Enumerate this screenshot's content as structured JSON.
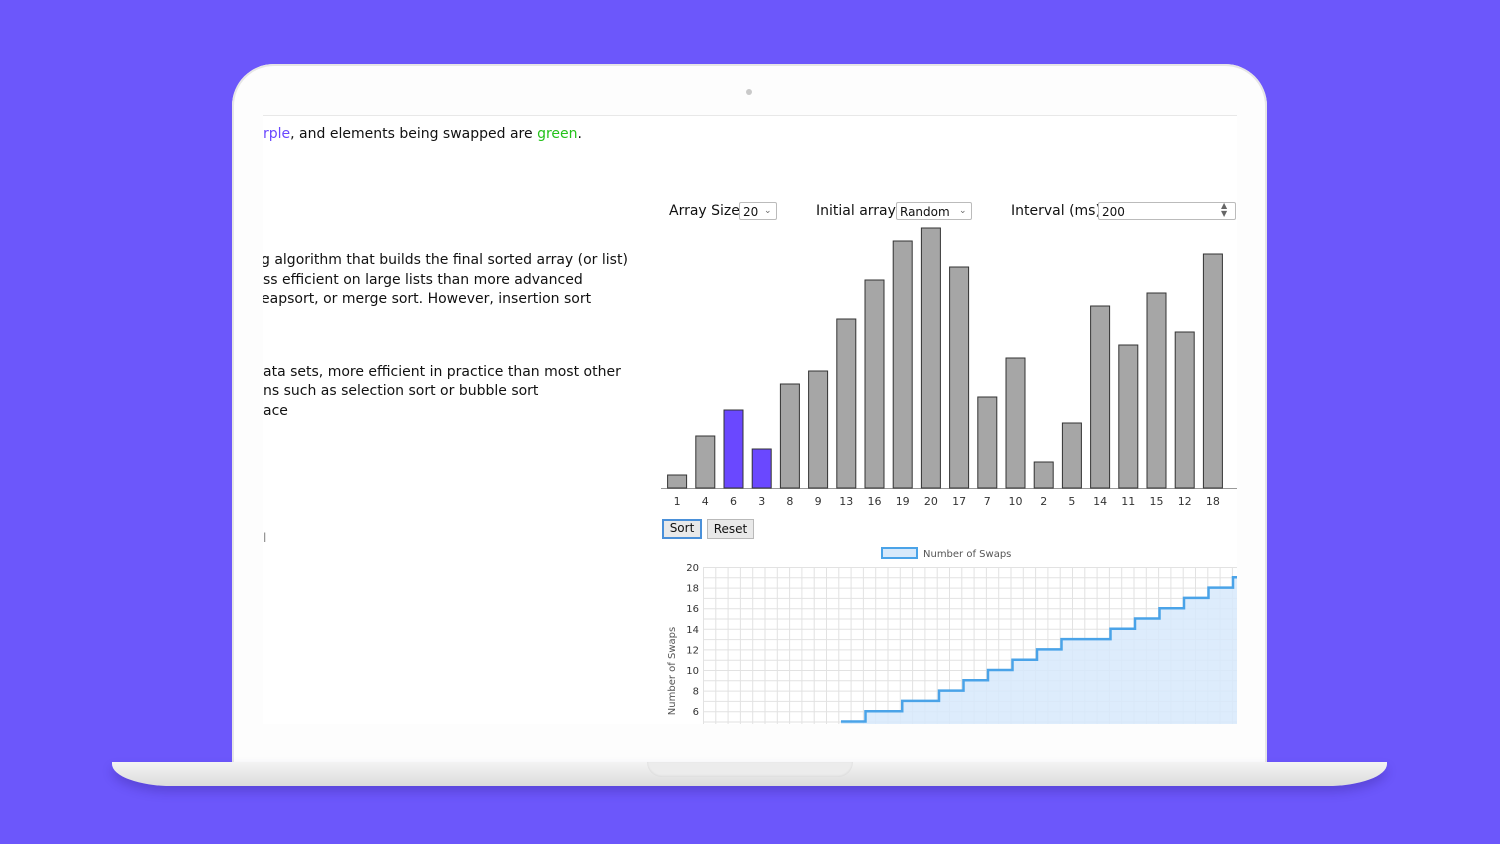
{
  "intro": {
    "prefix": "rple",
    "middle": ", and elements being swapped are ",
    "green_word": "green",
    "suffix": "."
  },
  "description": {
    "lines_a": [
      "g algorithm that builds the final sorted array (or list)",
      "ss efficient on large lists than more advanced",
      "eapsort, or merge sort. However, insertion sort"
    ],
    "lines_b": [
      "ata sets, more efficient in practice than most other",
      "ns such as selection sort or bubble sort",
      "ace"
    ],
    "fragment": "l"
  },
  "controls": {
    "array_size_label": "Array Size",
    "array_size_value": "20",
    "initial_array_label": "Initial array",
    "initial_array_value": "Random",
    "interval_label": "Interval (ms)",
    "interval_value": "200",
    "sort_label": "Sort",
    "reset_label": "Reset"
  },
  "colors": {
    "background": "#6c57fb",
    "compared": "#6a48ff",
    "swapped": "#24c21a",
    "bar": "#a6a6a6",
    "swap_line": "#4aa3e8",
    "swap_fill": "#d7e9fb"
  },
  "chart_data": [
    {
      "type": "bar",
      "categories": [
        "1",
        "4",
        "6",
        "3",
        "8",
        "9",
        "13",
        "16",
        "19",
        "20",
        "17",
        "7",
        "10",
        "2",
        "5",
        "14",
        "11",
        "15",
        "12",
        "18"
      ],
      "values": [
        1,
        4,
        6,
        3,
        8,
        9,
        13,
        16,
        19,
        20,
        17,
        7,
        10,
        2,
        5,
        14,
        11,
        15,
        12,
        18
      ],
      "highlighted_indices": [
        2,
        3
      ],
      "ylim": [
        0,
        20
      ]
    },
    {
      "type": "area",
      "legend": "Number of Swaps",
      "ylabel": "Number of Swaps",
      "yticks": [
        20,
        18,
        16,
        14,
        12,
        10,
        8,
        6
      ],
      "ylim": [
        5,
        20
      ],
      "x": [
        0,
        1,
        2,
        3,
        4,
        5,
        6,
        7,
        8,
        9,
        10,
        11,
        12,
        13,
        14,
        15,
        16,
        17,
        18,
        19,
        20,
        21,
        22,
        23,
        24,
        25,
        26,
        27,
        28,
        29,
        30,
        31,
        32,
        33,
        34,
        35,
        36,
        37,
        38
      ],
      "values": [
        null,
        null,
        null,
        null,
        null,
        null,
        null,
        null,
        null,
        null,
        null,
        null,
        null,
        null,
        null,
        null,
        null,
        null,
        null,
        null,
        null,
        null,
        null,
        null,
        null,
        null,
        null,
        5,
        6,
        7,
        8,
        9,
        10,
        11,
        12,
        13,
        14,
        15,
        16
      ],
      "series_steps": [
        {
          "x": 0,
          "y": 5
        },
        {
          "x": 1,
          "y": 6
        },
        {
          "x": 2.5,
          "y": 7
        },
        {
          "x": 4,
          "y": 8
        },
        {
          "x": 5,
          "y": 9
        },
        {
          "x": 6,
          "y": 10
        },
        {
          "x": 7,
          "y": 11
        },
        {
          "x": 8,
          "y": 12
        },
        {
          "x": 9,
          "y": 13
        },
        {
          "x": 11,
          "y": 14
        },
        {
          "x": 12,
          "y": 15
        },
        {
          "x": 13,
          "y": 16
        },
        {
          "x": 14,
          "y": 17
        },
        {
          "x": 15,
          "y": 18
        },
        {
          "x": 16,
          "y": 19
        }
      ]
    }
  ]
}
